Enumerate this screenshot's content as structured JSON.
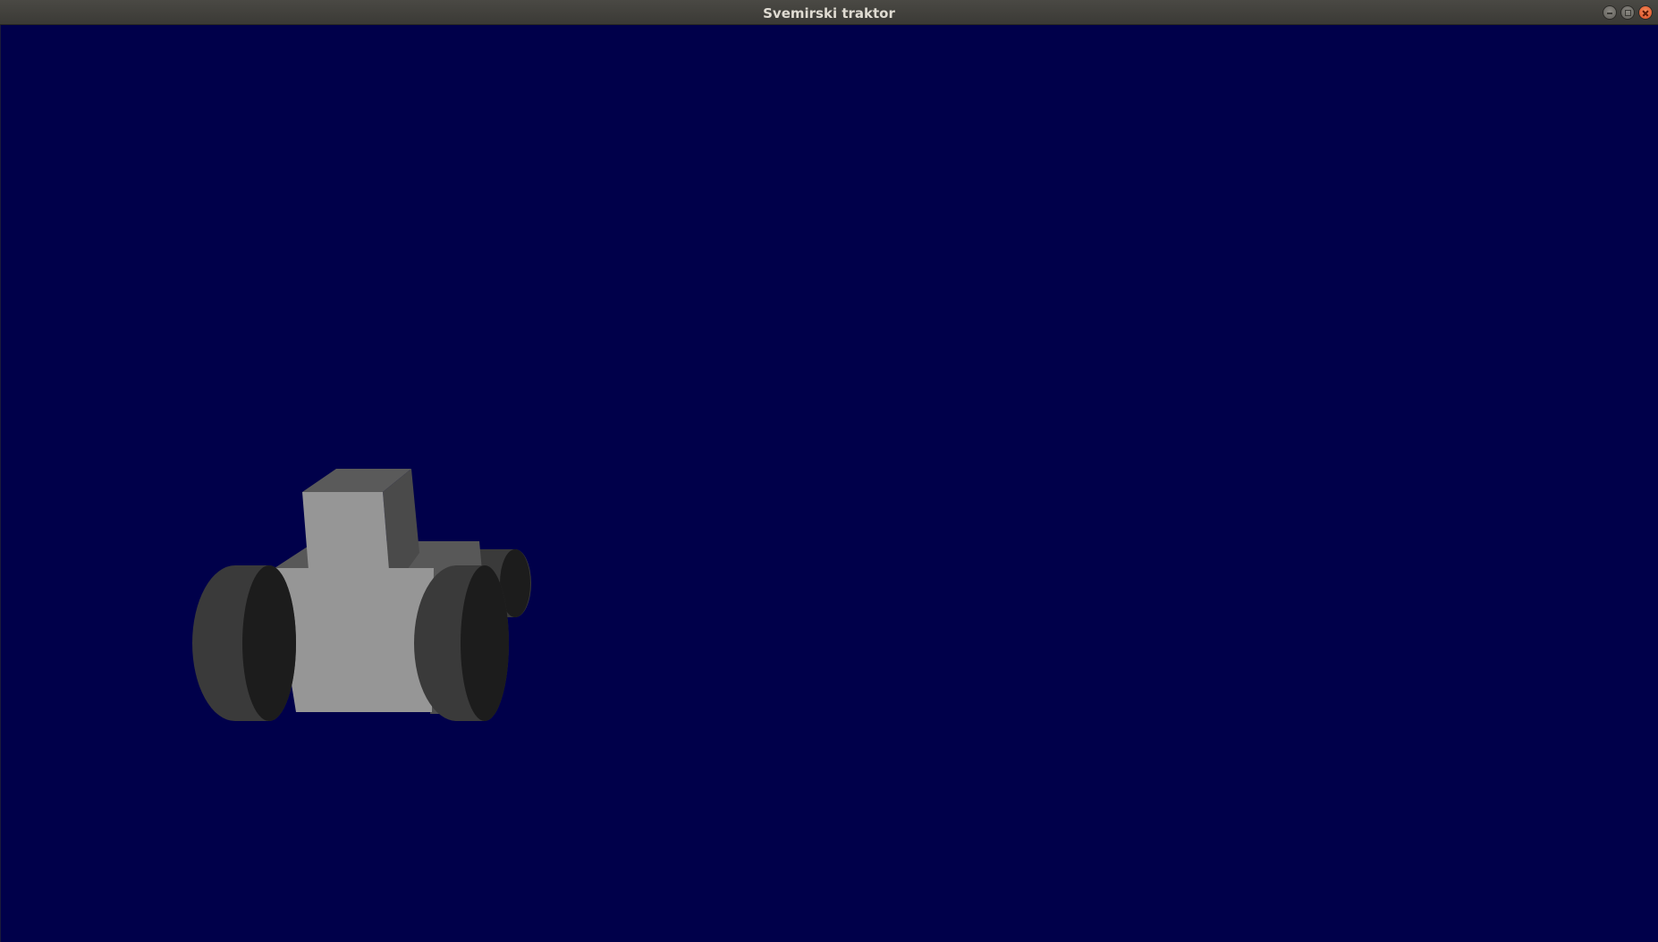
{
  "window": {
    "title": "Svemirski traktor",
    "background_color": "#00004a",
    "controls": {
      "minimize_icon": "minimize-icon",
      "maximize_icon": "maximize-icon",
      "close_icon": "close-icon"
    }
  },
  "scene": {
    "object": "tractor",
    "colors": {
      "body_front": "#969696",
      "body_side": "#585858",
      "wheel_tread": "#3a3a3a",
      "wheel_face": "#1c1c1c"
    }
  }
}
